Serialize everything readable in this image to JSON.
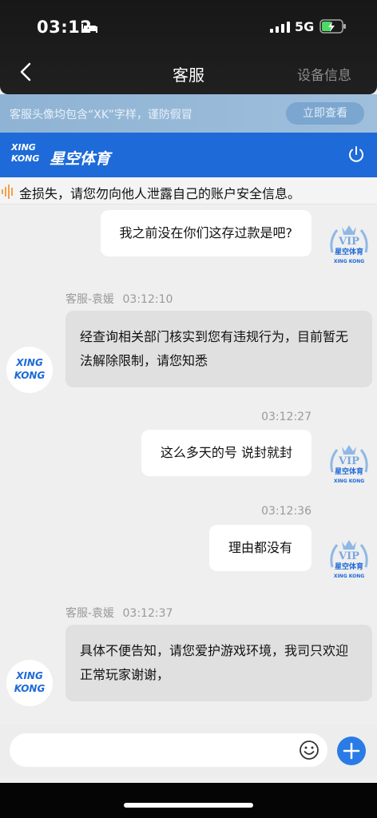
{
  "status_bar": {
    "time": "03:12",
    "network": "5G"
  },
  "nav": {
    "title": "客服",
    "right_label": "设备信息"
  },
  "banner": {
    "text": "客服头像均包含“XK”字样，谨防假冒",
    "button_label": "立即查看"
  },
  "brand": {
    "logo_text_top": "XING",
    "logo_text_bottom": "KONG",
    "logo_cn": "星空体育"
  },
  "notice": {
    "text": "金损失，请您勿向他人泄露自己的账户安全信息。"
  },
  "messages": [
    {
      "side": "right",
      "text": "我之前没在你们这存过款是吧?"
    },
    {
      "side": "left",
      "sender": "客服-袁媛",
      "time": "03:12:10",
      "text": "经查询相关部门核实到您有违规行为，目前暂无法解除限制，请您知悉"
    },
    {
      "side": "right",
      "time": "03:12:27",
      "text": "这么多天的号 说封就封"
    },
    {
      "side": "right",
      "time": "03:12:36",
      "text": "理由都没有"
    },
    {
      "side": "left",
      "sender": "客服-袁媛",
      "time": "03:12:37",
      "text": "具体不便告知，请您爱护游戏环境，我司只欢迎正常玩家谢谢，"
    }
  ],
  "avatars": {
    "vip_label": "VIP",
    "vip_cn": "星空体育",
    "vip_xk": "XING KONG",
    "agent_top": "XING",
    "agent_bottom": "KONG"
  },
  "input": {
    "placeholder": ""
  },
  "colors": {
    "brand_blue": "#1d6ad8",
    "banner_blue": "#9fbfdc",
    "plus_button": "#2a7be6"
  }
}
